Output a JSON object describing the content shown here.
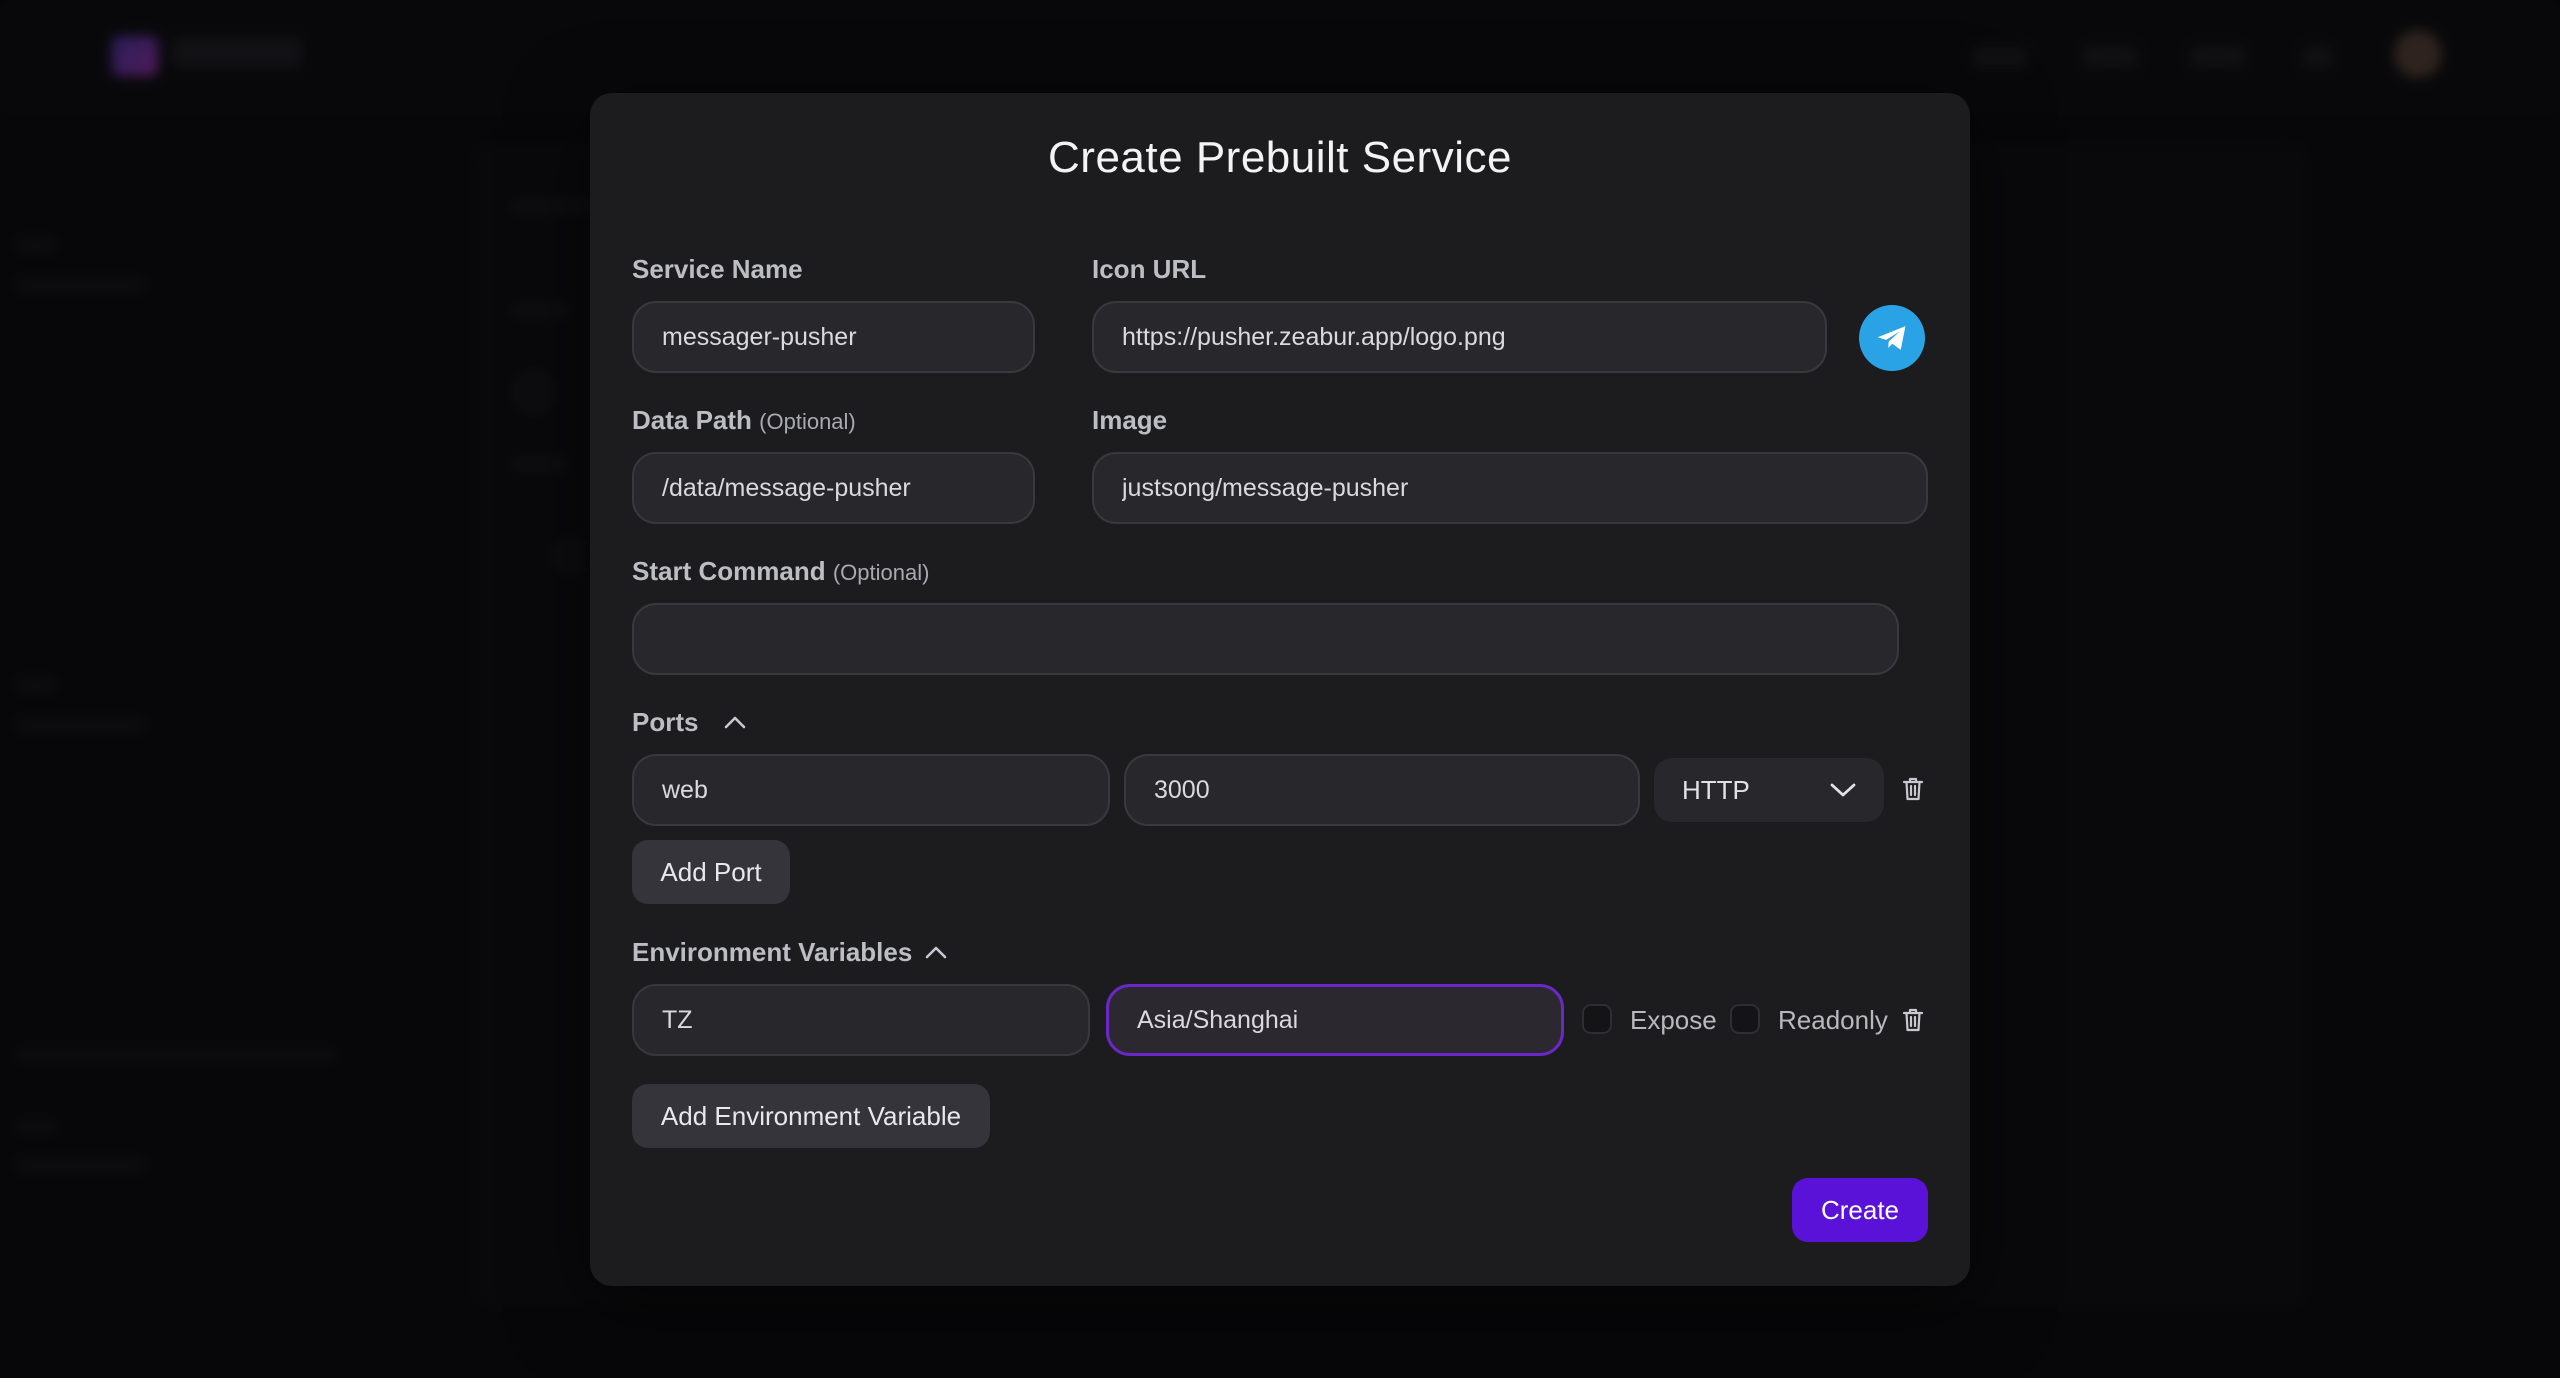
{
  "modal": {
    "title": "Create Prebuilt Service"
  },
  "service_name": {
    "label": "Service Name",
    "value": "messager-pusher"
  },
  "icon_url": {
    "label": "Icon URL",
    "value": "https://pusher.zeabur.app/logo.png",
    "preview_icon": "telegram-icon"
  },
  "data_path": {
    "label": "Data Path",
    "optional": "(Optional)",
    "value": "/data/message-pusher"
  },
  "image": {
    "label": "Image",
    "value": "justsong/message-pusher"
  },
  "start_command": {
    "label": "Start Command",
    "optional": "(Optional)",
    "value": ""
  },
  "ports": {
    "title": "Ports",
    "items": [
      {
        "name": "web",
        "port": "3000",
        "protocol": "HTTP"
      }
    ],
    "add_label": "Add Port"
  },
  "env": {
    "title": "Environment Variables",
    "items": [
      {
        "key": "TZ",
        "value": "Asia/Shanghai",
        "expose_label": "Expose",
        "readonly_label": "Readonly"
      }
    ],
    "add_label": "Add Environment Variable"
  },
  "actions": {
    "create_label": "Create"
  },
  "colors": {
    "accent": "#5b12d8",
    "focus_border": "#6a28c8",
    "icon_bg": "#2aa3e6"
  }
}
